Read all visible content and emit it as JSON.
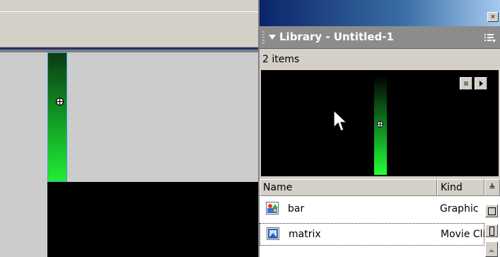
{
  "library_panel": {
    "title": "Library - Untitled-1",
    "item_count": "2 items",
    "close_glyph": "×",
    "columns": {
      "name": "Name",
      "kind": "Kind",
      "sort_glyph": "≜"
    },
    "items": [
      {
        "name": "bar",
        "kind": "Graphic",
        "icon": "graphic-symbol-icon"
      },
      {
        "name": "matrix",
        "kind": "Movie Clip",
        "icon": "movie-clip-icon"
      }
    ]
  },
  "colors": {
    "stage_grey": "#cccccc",
    "panel_header": "#8c8c8c",
    "bar_green": "#22ee33",
    "selection_blue": "#2fa3df"
  }
}
